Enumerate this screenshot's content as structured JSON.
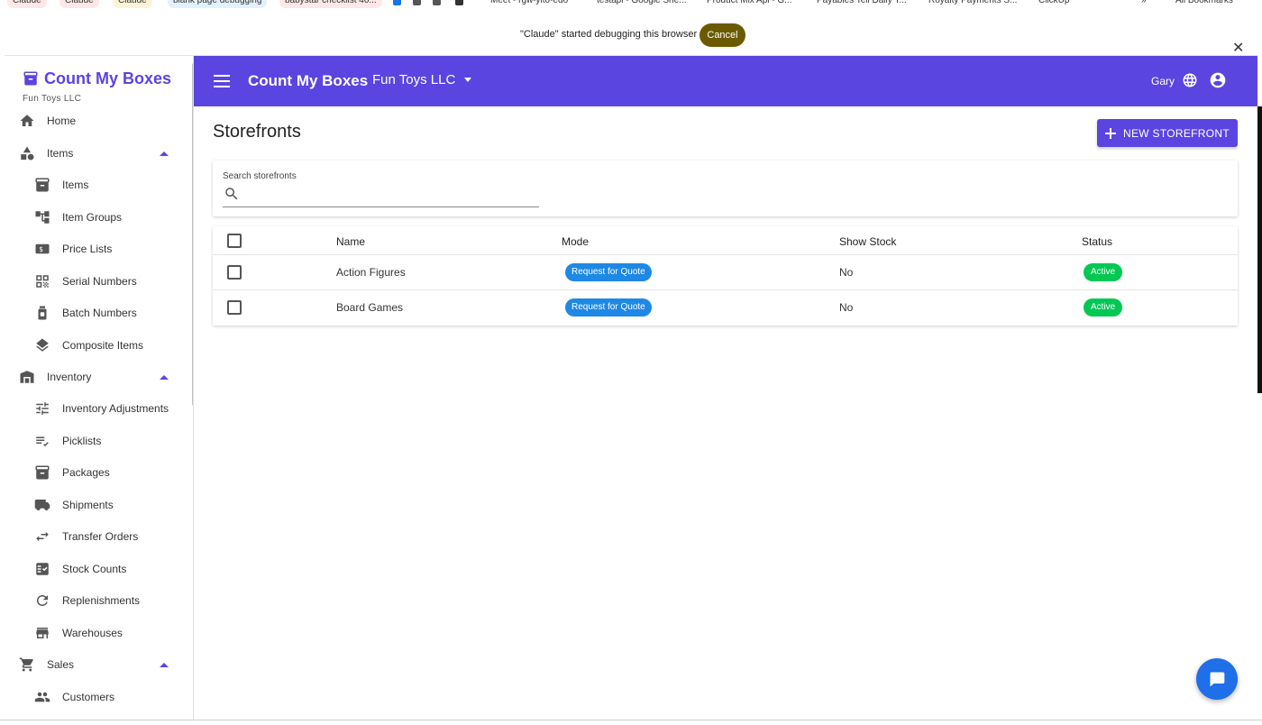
{
  "bookmarks": [
    {
      "label": "Claude",
      "bg": "#fde7e7"
    },
    {
      "label": "Claude",
      "bg": "#fde7e7"
    },
    {
      "label": "Claude",
      "bg": "#fdf3d6"
    },
    {
      "label": "blank page debugging",
      "bg": "#e3f0fd"
    },
    {
      "label": "babystar checklist 40...",
      "bg": "#fde7e7"
    },
    {
      "label": "Meet - rgw-yit0-edo",
      "bg": "#ffffff"
    },
    {
      "label": "testapi - Google She...",
      "bg": "#ffffff"
    },
    {
      "label": "Product Mix Api - G...",
      "bg": "#ffffff"
    },
    {
      "label": "Payables Tell Daily T...",
      "bg": "#ffffff"
    },
    {
      "label": "Royalty Payments S...",
      "bg": "#ffffff"
    },
    {
      "label": "ClickUp",
      "bg": "#ffffff"
    },
    {
      "label": "All Bookmarks",
      "bg": "#ffffff"
    }
  ],
  "debug_banner": {
    "message": "\"Claude\" started debugging this browser",
    "cancel_label": "Cancel",
    "close_icon": "close-icon"
  },
  "sidebar": {
    "app_name": "Count My Boxes",
    "org_name": "Fun Toys LLC",
    "items": [
      {
        "label": "Home",
        "icon": "home-icon",
        "level": 0
      },
      {
        "label": "Items",
        "icon": "shapes-icon",
        "level": 0,
        "expanded": true
      },
      {
        "label": "Items",
        "icon": "archive-box-icon",
        "level": 1
      },
      {
        "label": "Item Groups",
        "icon": "hierarchy-icon",
        "level": 1
      },
      {
        "label": "Price Lists",
        "icon": "price-tag-icon",
        "level": 1
      },
      {
        "label": "Serial Numbers",
        "icon": "qr-code-icon",
        "level": 1
      },
      {
        "label": "Batch Numbers",
        "icon": "jar-icon",
        "level": 1
      },
      {
        "label": "Composite Items",
        "icon": "layers-icon",
        "level": 1
      },
      {
        "label": "Inventory",
        "icon": "warehouse-icon",
        "level": 0,
        "expanded": true
      },
      {
        "label": "Inventory Adjustments",
        "icon": "sliders-icon",
        "level": 1
      },
      {
        "label": "Picklists",
        "icon": "checklist-icon",
        "level": 1
      },
      {
        "label": "Packages",
        "icon": "package-icon",
        "level": 1
      },
      {
        "label": "Shipments",
        "icon": "truck-icon",
        "level": 1
      },
      {
        "label": "Transfer Orders",
        "icon": "swap-arrows-icon",
        "level": 1
      },
      {
        "label": "Stock Counts",
        "icon": "checkbox-list-icon",
        "level": 1
      },
      {
        "label": "Replenishments",
        "icon": "refresh-icon",
        "level": 1
      },
      {
        "label": "Warehouses",
        "icon": "store-icon",
        "level": 1
      },
      {
        "label": "Sales",
        "icon": "cart-icon",
        "level": 0,
        "expanded": true
      },
      {
        "label": "Customers",
        "icon": "people-icon",
        "level": 1
      }
    ]
  },
  "header": {
    "title": "Count My Boxes",
    "org_selector": "Fun Toys LLC",
    "user_name": "Gary"
  },
  "main": {
    "page_title": "Storefronts",
    "new_button_label": "NEW STOREFRONT",
    "search": {
      "label": "Search storefronts",
      "value": "",
      "placeholder": ""
    },
    "table": {
      "columns": [
        "Name",
        "Mode",
        "Show Stock",
        "Status"
      ],
      "rows": [
        {
          "name": "Action Figures",
          "mode": "Request for Quote",
          "show_stock": "No",
          "status": "Active"
        },
        {
          "name": "Board Games",
          "mode": "Request for Quote",
          "show_stock": "No",
          "status": "Active"
        }
      ]
    }
  },
  "colors": {
    "brand": "#5b45e0",
    "mode_badge": "#1e88e5",
    "status_active": "#00c853",
    "chat": "#1e6fe8"
  }
}
